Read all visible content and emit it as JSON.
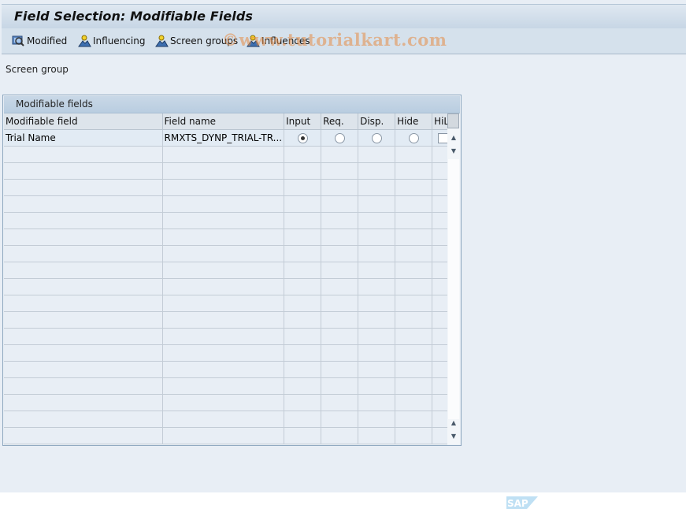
{
  "window": {
    "title": "Field Selection: Modifiable Fields"
  },
  "toolbar": {
    "buttons": [
      {
        "label": "Modified",
        "icon": "magnifier-icon"
      },
      {
        "label": "Influencing",
        "icon": "person-mountain-icon"
      },
      {
        "label": "Screen groups",
        "icon": "person-mountain-icon"
      },
      {
        "label": "Influences",
        "icon": "person-mountain-icon"
      }
    ]
  },
  "watermark": "©www.tutorialkart.com",
  "screen_group": {
    "label": "Screen group"
  },
  "panel": {
    "title": "Modifiable fields",
    "columns": [
      "Modifiable field",
      "Field name",
      "Input",
      "Req.",
      "Disp.",
      "Hide",
      "HiLi"
    ],
    "rows": [
      {
        "modifiable_field": "Trial Name",
        "field_name": "RMXTS_DYNP_TRIAL-TR...",
        "selected_option": "Input",
        "hili": false
      }
    ],
    "empty_rows": 18
  },
  "branding": {
    "logo": "SAP"
  }
}
